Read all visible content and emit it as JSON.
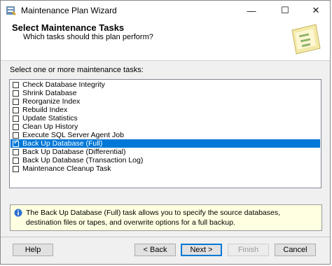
{
  "window": {
    "title": "Maintenance Plan Wizard"
  },
  "header": {
    "title": "Select Maintenance Tasks",
    "subtitle": "Which tasks should this plan perform?"
  },
  "tasks_label": "Select one or more maintenance tasks:",
  "tasks": [
    {
      "label": "Check Database Integrity",
      "checked": false,
      "selected": false
    },
    {
      "label": "Shrink Database",
      "checked": false,
      "selected": false
    },
    {
      "label": "Reorganize Index",
      "checked": false,
      "selected": false
    },
    {
      "label": "Rebuild Index",
      "checked": false,
      "selected": false
    },
    {
      "label": "Update Statistics",
      "checked": false,
      "selected": false
    },
    {
      "label": "Clean Up History",
      "checked": false,
      "selected": false
    },
    {
      "label": "Execute SQL Server Agent Job",
      "checked": false,
      "selected": false
    },
    {
      "label": "Back Up Database (Full)",
      "checked": true,
      "selected": true
    },
    {
      "label": "Back Up Database (Differential)",
      "checked": false,
      "selected": false
    },
    {
      "label": "Back Up Database (Transaction Log)",
      "checked": false,
      "selected": false
    },
    {
      "label": "Maintenance Cleanup Task",
      "checked": false,
      "selected": false
    }
  ],
  "description": "The Back Up Database (Full) task allows you to specify the source databases, destination files or tapes, and overwrite options for a full backup.",
  "buttons": {
    "help": "Help",
    "back": "< Back",
    "next": "Next >",
    "finish": "Finish",
    "cancel": "Cancel"
  },
  "icons": {
    "app": "wizard-app-icon",
    "header_art": "tasks-illustration-icon",
    "info": "info-icon",
    "minimize": "minimize-icon",
    "maximize": "maximize-icon",
    "close": "close-icon"
  },
  "colors": {
    "selection": "#0078d7",
    "description_bg": "#ffffe1",
    "dialog_bg": "#f0f0f0"
  }
}
